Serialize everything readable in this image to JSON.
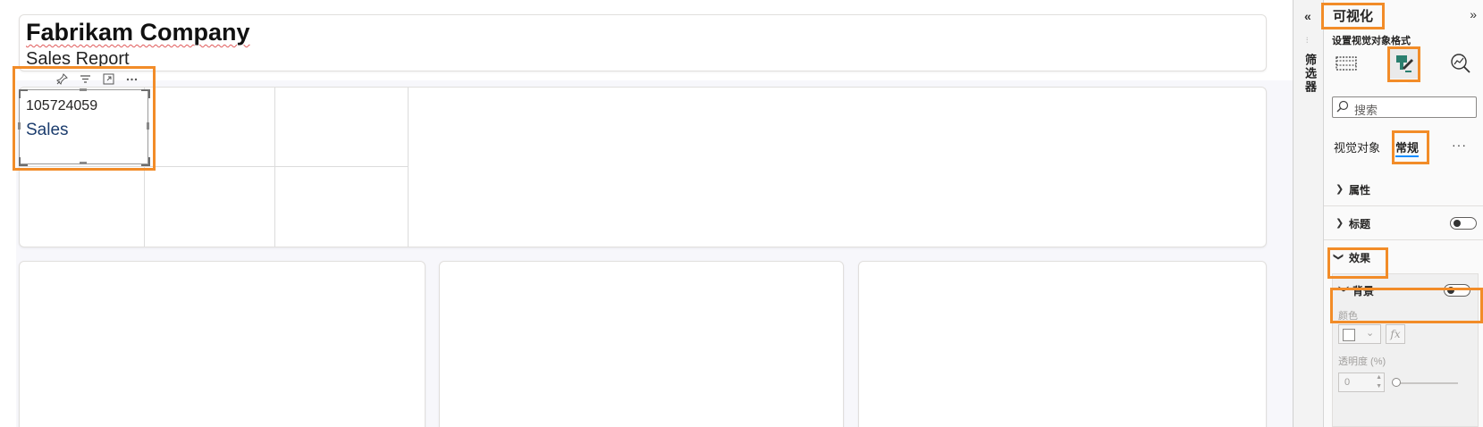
{
  "report": {
    "company": "Fabrikam Company",
    "subtitle": "Sales Report",
    "kpi_value": "105724059",
    "kpi_label": "Sales"
  },
  "card_toolbar": {
    "icons": [
      "pin-icon",
      "filter-icon",
      "focus-mode-icon",
      "more-options-icon"
    ]
  },
  "filters_pane": {
    "label": "筛选器",
    "collapse_glyph": "«",
    "grip_glyph": "⫶"
  },
  "viz_pane": {
    "title": "可视化",
    "collapse_glyph": "»",
    "subtitle": "设置视觉对象格式",
    "icon_tabs": [
      "build-visual-icon",
      "format-visual-icon",
      "analytics-icon"
    ],
    "search_placeholder": "搜索",
    "tabs": {
      "visual": "视觉对象",
      "general": "常规",
      "more": "···"
    },
    "sections": {
      "properties": "属性",
      "title": "标题",
      "effects": "效果",
      "background": "背景"
    },
    "background": {
      "color_label": "颜色",
      "fx": "fx",
      "transparency_label": "透明度 (%)",
      "transparency_value": "0"
    }
  },
  "colors": {
    "highlight": "#f28c28",
    "accent": "#118dff",
    "kpi_label": "#1c3d6e"
  }
}
